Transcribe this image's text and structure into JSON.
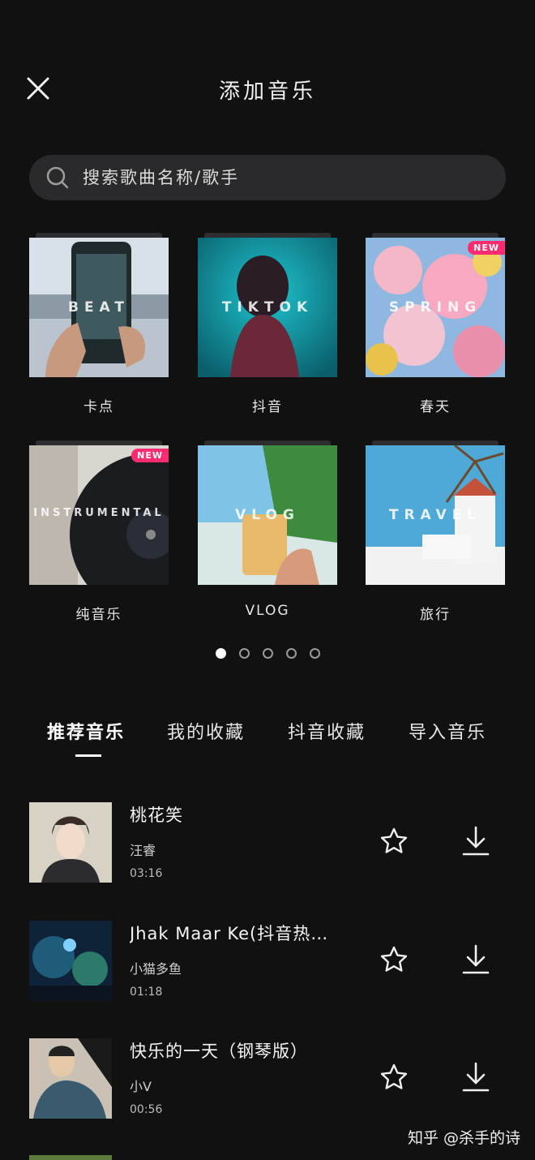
{
  "header": {
    "title": "添加音乐",
    "close_icon": "close-icon"
  },
  "search": {
    "placeholder": "搜索歌曲名称/歌手",
    "icon": "search-icon"
  },
  "categories": [
    {
      "label": "卡点",
      "cover_text": "BEAT",
      "badge": ""
    },
    {
      "label": "抖音",
      "cover_text": "TIKTOK",
      "badge": ""
    },
    {
      "label": "春天",
      "cover_text": "SPRING",
      "badge": "NEW"
    },
    {
      "label": "纯音乐",
      "cover_text": "INSTRUMENTAL",
      "badge": "NEW"
    },
    {
      "label": "VLOG",
      "cover_text": "VLOG",
      "badge": ""
    },
    {
      "label": "旅行",
      "cover_text": "TRAVEL",
      "badge": ""
    }
  ],
  "pagination": {
    "pages": 5,
    "current": 1
  },
  "tabs": [
    {
      "label": "推荐音乐",
      "active": true
    },
    {
      "label": "我的收藏",
      "active": false
    },
    {
      "label": "抖音收藏",
      "active": false
    },
    {
      "label": "导入音乐",
      "active": false
    }
  ],
  "songs": [
    {
      "title": "桃花笑",
      "artist": "汪睿",
      "duration": "03:16"
    },
    {
      "title": "Jhak Maar Ke(抖音热…",
      "artist": "小猫多鱼",
      "duration": "01:18"
    },
    {
      "title": "快乐的一天（钢琴版）",
      "artist": "小V",
      "duration": "00:56"
    }
  ],
  "watermark": "知乎 @杀手的诗",
  "colors": {
    "background": "#111112",
    "search_bg": "#2a2a2c",
    "badge": "#ff2d6f"
  }
}
